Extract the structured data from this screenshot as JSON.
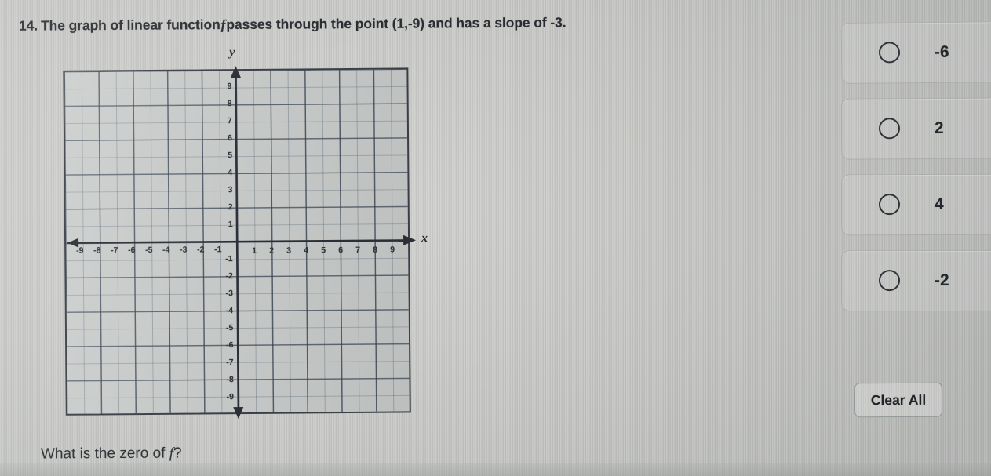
{
  "question": {
    "number": "14.",
    "text_before_f": "The graph of linear function",
    "f_symbol": "f",
    "text_after_f": "passes through the point (1,-9) and has a slope of -3."
  },
  "graph": {
    "x_axis_label": "x",
    "y_axis_label": "y",
    "x_ticks_negative": [
      "-9",
      "-8",
      "-7",
      "-6",
      "-5",
      "-4",
      "-3",
      "-2",
      "-1"
    ],
    "x_ticks_positive": [
      "1",
      "2",
      "3",
      "4",
      "5",
      "6",
      "7",
      "8",
      "9"
    ],
    "y_ticks_positive": [
      "9",
      "8",
      "7",
      "6",
      "5",
      "4",
      "3",
      "2",
      "1"
    ],
    "y_ticks_negative": [
      "-1",
      "-2",
      "-3",
      "-4",
      "-5",
      "-6",
      "-7",
      "-8",
      "-9"
    ]
  },
  "chart_data": {
    "type": "line",
    "title": "",
    "xlabel": "x",
    "ylabel": "y",
    "xlim": [
      -10,
      10
    ],
    "ylim": [
      -10,
      10
    ],
    "xticks": [
      -9,
      -8,
      -7,
      -6,
      -5,
      -4,
      -3,
      -2,
      -1,
      1,
      2,
      3,
      4,
      5,
      6,
      7,
      8,
      9
    ],
    "yticks": [
      -9,
      -8,
      -7,
      -6,
      -5,
      -4,
      -3,
      -2,
      -1,
      1,
      2,
      3,
      4,
      5,
      6,
      7,
      8,
      9
    ],
    "grid": true,
    "minor_grid_step": 0.5,
    "major_grid_step": 1,
    "legend": "none",
    "series": [
      {
        "name": "f",
        "values": [],
        "note": "blank coordinate grid, no line plotted"
      }
    ]
  },
  "choices": [
    {
      "value": "-6",
      "selected": false
    },
    {
      "value": "2",
      "selected": false
    },
    {
      "value": "4",
      "selected": false
    },
    {
      "value": "-2",
      "selected": false
    }
  ],
  "controls": {
    "clear_all_label": "Clear All"
  },
  "bottom": {
    "prompt_before_f": "What is the zero of",
    "f_symbol": "f",
    "prompt_after_f": "?"
  }
}
